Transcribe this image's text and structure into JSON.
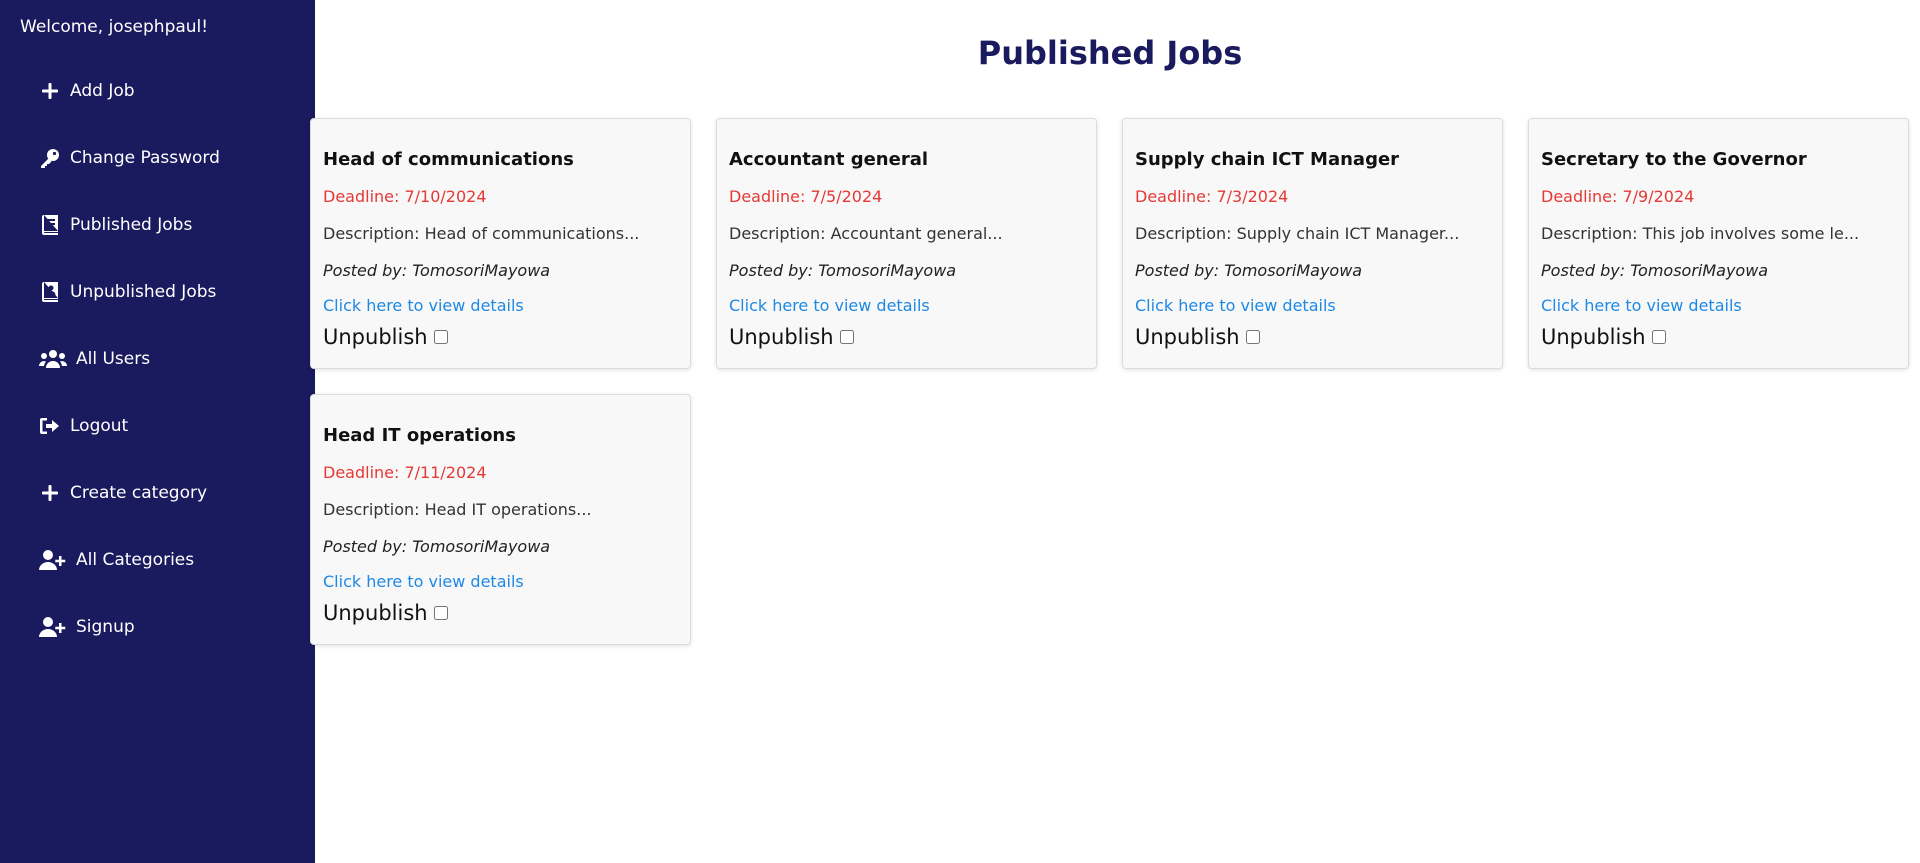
{
  "sidebar": {
    "welcome": "Welcome, josephpaul!",
    "items": [
      {
        "label": "Add Job",
        "icon": "plus-icon"
      },
      {
        "label": "Change Password",
        "icon": "key-icon"
      },
      {
        "label": "Published Jobs",
        "icon": "book-icon"
      },
      {
        "label": "Unpublished Jobs",
        "icon": "book-user-icon"
      },
      {
        "label": "All Users",
        "icon": "users-icon"
      },
      {
        "label": "Logout",
        "icon": "logout-icon"
      },
      {
        "label": "Create category",
        "icon": "plus-icon"
      },
      {
        "label": "All Categories",
        "icon": "user-plus-icon"
      },
      {
        "label": "Signup",
        "icon": "user-plus-icon"
      }
    ]
  },
  "main": {
    "title": "Published Jobs",
    "unpublish_label": "Unpublish",
    "link_label": "Click here to view details",
    "jobs": [
      {
        "title": "Head of communications",
        "deadline": "Deadline: 7/10/2024",
        "description": "Description: Head of communications...",
        "posted_by": "Posted by: TomosoriMayowa"
      },
      {
        "title": "Accountant general",
        "deadline": "Deadline: 7/5/2024",
        "description": "Description: Accountant general...",
        "posted_by": "Posted by: TomosoriMayowa"
      },
      {
        "title": "Supply chain ICT Manager",
        "deadline": "Deadline: 7/3/2024",
        "description": "Description: Supply chain ICT Manager...",
        "posted_by": "Posted by: TomosoriMayowa"
      },
      {
        "title": "Secretary to the Governor",
        "deadline": "Deadline: 7/9/2024",
        "description": "Description: This job involves some le...",
        "posted_by": "Posted by: TomosoriMayowa"
      },
      {
        "title": "Head IT operations",
        "deadline": "Deadline: 7/11/2024",
        "description": "Description: Head IT operations...",
        "posted_by": "Posted by: TomosoriMayowa"
      }
    ]
  },
  "colors": {
    "sidebar_bg": "#1a1a5e",
    "title": "#1a1a5e",
    "deadline": "#e53935",
    "link": "#1e88e5"
  }
}
